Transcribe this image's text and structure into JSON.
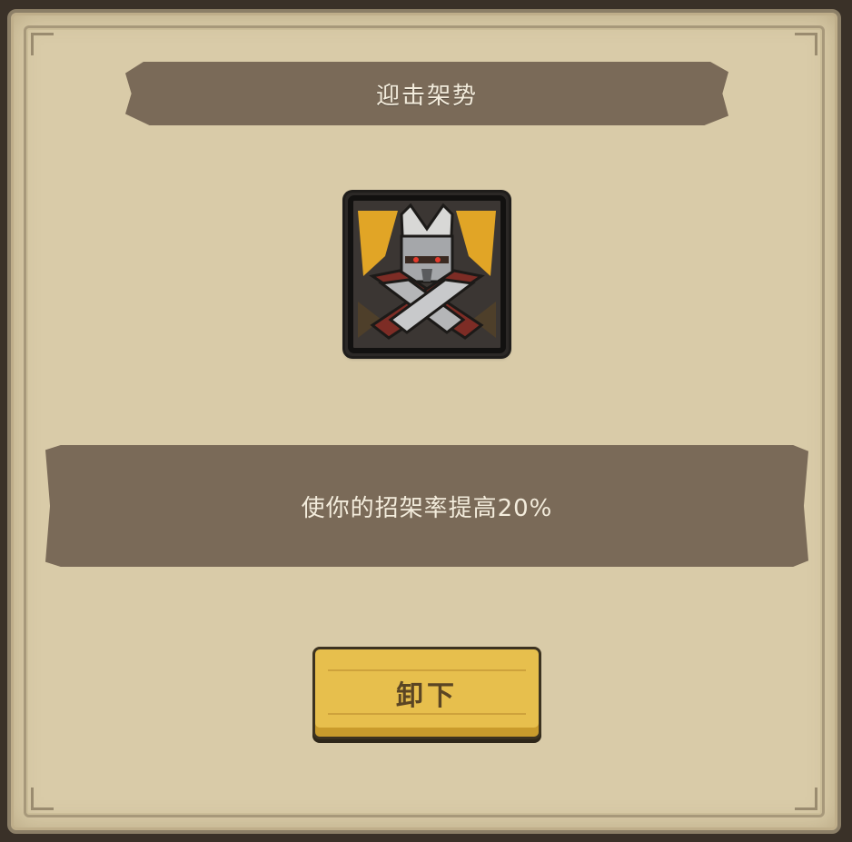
{
  "dialog": {
    "title": "迎击架势",
    "description": "使你的招架率提高20%",
    "button_label": "卸下"
  },
  "skill_icon": {
    "name": "parry-stance-icon"
  },
  "colors": {
    "panel_bg": "#d9cba8",
    "banner_bg": "#7a6a58",
    "banner_text": "#f3ecdc",
    "button_bg": "#e7bf4d",
    "button_text": "#5a4524"
  }
}
